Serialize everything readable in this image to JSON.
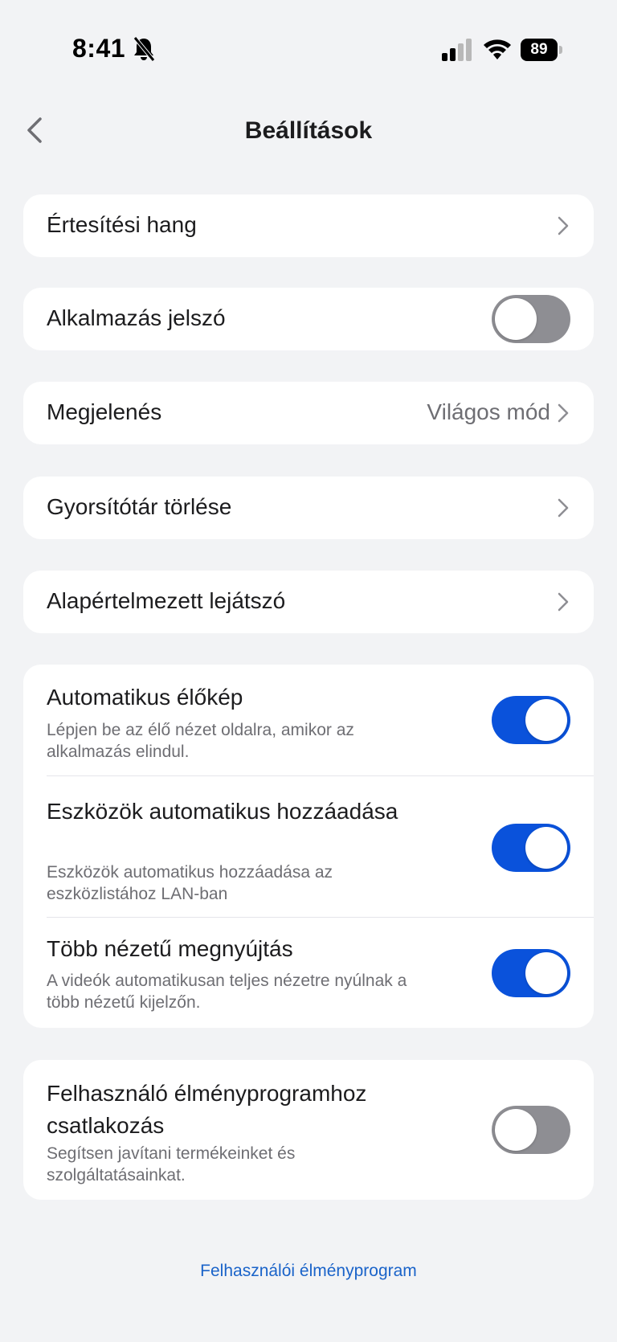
{
  "status_bar": {
    "time": "8:41",
    "battery": "89"
  },
  "nav": {
    "title": "Beállítások"
  },
  "rows": {
    "notification_sound": "Értesítési hang",
    "app_password": {
      "label": "Alkalmazás jelszó",
      "on": false
    },
    "appearance": {
      "label": "Megjelenés",
      "value": "Világos mód"
    },
    "clear_cache": "Gyorsítótár törlése",
    "default_player": "Alapértelmezett lejátszó"
  },
  "group": {
    "auto_preview": {
      "label": "Automatikus élőkép",
      "sub": "Lépjen be az élő nézet oldalra, amikor az alkalmazás elindul.",
      "on": true
    },
    "auto_add": {
      "label": "Eszközök automatikus hozzáadása",
      "sub": "Eszközök automatikus hozzáadása az eszközlistához LAN-ban",
      "on": true
    },
    "multi_stretch": {
      "label": "Több nézetű megnyújtás",
      "sub": "A videók automatikusan teljes nézetre nyúlnak a több nézetű kijelzőn.",
      "on": true
    }
  },
  "ux_program": {
    "label": "Felhasználó élményprogramhoz csatlakozás",
    "sub": "Segítsen javítani termékeinket és szolgáltatásainkat.",
    "on": false
  },
  "footer": {
    "link": "Felhasználói élményprogram"
  },
  "colors": {
    "accent": "#0a52db",
    "toggle_off": "#8e8e93",
    "link": "#1a63c9",
    "background": "#f2f3f5"
  }
}
